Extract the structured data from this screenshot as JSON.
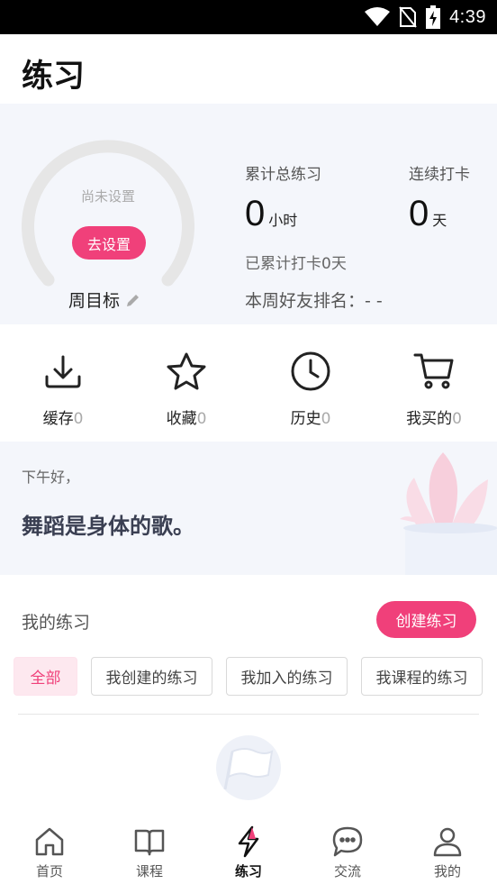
{
  "status_bar": {
    "time": "4:39",
    "icons": [
      "wifi-icon",
      "no-sim-icon",
      "battery-charging-icon"
    ]
  },
  "header": {
    "title": "练习"
  },
  "goal": {
    "status_text": "尚未设置",
    "set_button_label": "去设置",
    "label": "周目标",
    "edit_icon": "pencil-icon"
  },
  "stats": {
    "total_label": "累计总练习",
    "total_value": "0",
    "total_unit": "小时",
    "streak_label": "连续打卡",
    "streak_value": "0",
    "streak_unit": "天",
    "checkin_text": "已累计打卡0天",
    "friend_rank_text": "本周好友排名：- -"
  },
  "quick_actions": [
    {
      "icon": "download-icon",
      "label": "缓存",
      "count": "0"
    },
    {
      "icon": "star-icon",
      "label": "收藏",
      "count": "0"
    },
    {
      "icon": "clock-icon",
      "label": "历史",
      "count": "0"
    },
    {
      "icon": "cart-icon",
      "label": "我买的",
      "count": "0"
    }
  ],
  "greeting": {
    "sub": "下午好，",
    "main": "舞蹈是身体的歌。"
  },
  "practice": {
    "title": "我的练习",
    "create_label": "创建练习",
    "filters": [
      "全部",
      "我创建的练习",
      "我加入的练习",
      "我课程的练习"
    ],
    "active_filter": "全部"
  },
  "bottom_nav": [
    {
      "icon": "home-icon",
      "label": "首页"
    },
    {
      "icon": "book-icon",
      "label": "课程"
    },
    {
      "icon": "lightning-icon",
      "label": "练习",
      "active": true
    },
    {
      "icon": "chat-icon",
      "label": "交流"
    },
    {
      "icon": "profile-icon",
      "label": "我的"
    }
  ],
  "colors": {
    "accent": "#f0407a",
    "card_bg": "#f4f6fb",
    "ring_track": "#e6e6e6"
  }
}
